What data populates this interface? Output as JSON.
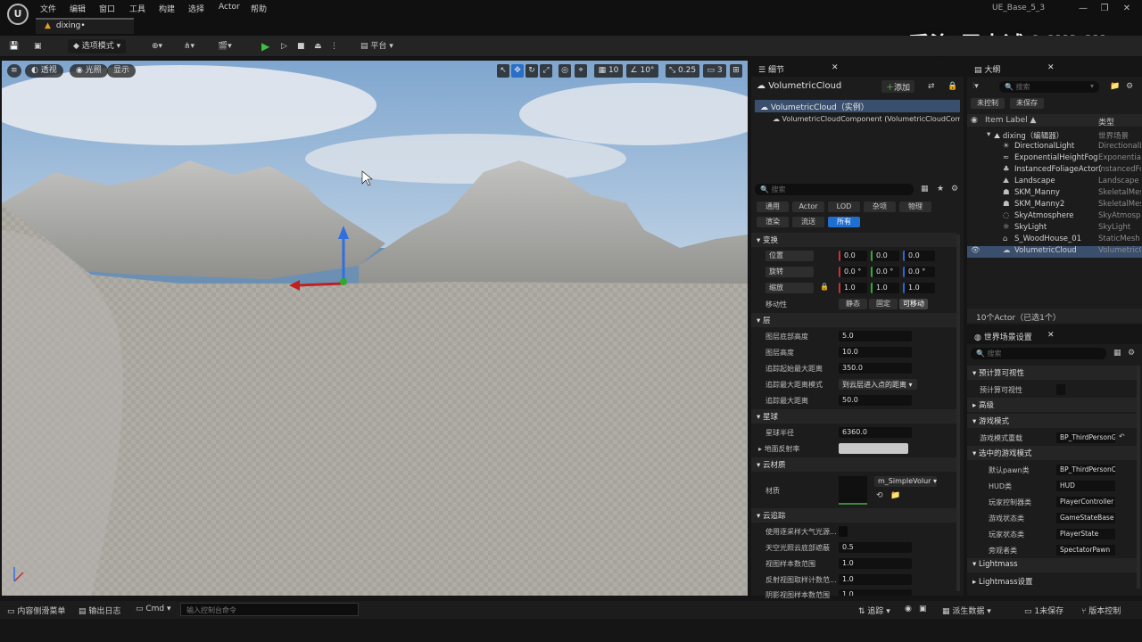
{
  "menu": [
    "文件",
    "编辑",
    "窗口",
    "工具",
    "构建",
    "选择",
    "Actor",
    "帮助"
  ],
  "map_tab": "dixing•",
  "project": "UE_Base_5_3",
  "watermark": "乔治-周士诚 bilibili",
  "toolbar": {
    "mode": "选项模式",
    "platform": "平台"
  },
  "viewport": {
    "perspective": "透视",
    "lit": "光照",
    "show": "显示",
    "grid": "10",
    "angle": "10°",
    "scale": "0.25",
    "camera": "3"
  },
  "details": {
    "tab": "细节",
    "actor": "VolumetricCloud",
    "add": "添加",
    "instance": "VolumetricCloud（实例）",
    "component": "VolumetricCloudComponent (VolumetricCloudComp",
    "search": "搜索",
    "filters": [
      "通用",
      "Actor",
      "LOD",
      "杂项",
      "物理",
      "渲染",
      "流送",
      "所有"
    ],
    "transform": {
      "section": "变换",
      "location": "位置",
      "rotation": "旋转",
      "scale": "缩放",
      "loc": [
        "0.0",
        "0.0",
        "0.0"
      ],
      "rot": [
        "0.0 °",
        "0.0 °",
        "0.0 °"
      ],
      "scl": [
        "1.0",
        "1.0",
        "1.0"
      ],
      "mobility": "移动性",
      "mob": [
        "静态",
        "固定",
        "可移动"
      ]
    },
    "layer": {
      "section": "层",
      "rows": [
        {
          "l": "图层底部高度",
          "v": "5.0"
        },
        {
          "l": "图层高度",
          "v": "10.0"
        },
        {
          "l": "追踪起始最大距离",
          "v": "350.0"
        },
        {
          "l": "追踪最大距离模式",
          "v": "到云层进入点的距离"
        },
        {
          "l": "追踪最大距离",
          "v": "50.0"
        }
      ]
    },
    "planet": {
      "section": "星球",
      "radius_l": "星球半径",
      "radius_v": "6360.0",
      "ground": "地面反射率"
    },
    "material": {
      "section": "云材质",
      "label": "材质",
      "value": "m_SimpleVolur"
    },
    "tracing": {
      "section": "云追踪",
      "rows": [
        {
          "l": "使用逐采样大气光源...",
          "v": ""
        },
        {
          "l": "天空光照云底部遮蔽",
          "v": "0.5"
        },
        {
          "l": "视图样本数范围",
          "v": "1.0"
        },
        {
          "l": "反射视图取样计数范...",
          "v": "1.0"
        },
        {
          "l": "阴影视图样本数范围",
          "v": "1.0"
        }
      ]
    }
  },
  "outliner": {
    "tab": "大纲",
    "search": "搜索",
    "unsaved_l": "未控制",
    "unsaved_r": "未保存",
    "col_label": "Item Label ▲",
    "col_type": "类型",
    "root": "dixing（编辑器）",
    "root_type": "世界场景",
    "items": [
      {
        "n": "DirectionalLight",
        "t": "DirectionalL"
      },
      {
        "n": "ExponentialHeightFog",
        "t": "ExponentialH"
      },
      {
        "n": "InstancedFoliageActor(",
        "t": "InstancedFo"
      },
      {
        "n": "Landscape",
        "t": "Landscape"
      },
      {
        "n": "SKM_Manny",
        "t": "SkeletalMes"
      },
      {
        "n": "SKM_Manny2",
        "t": "SkeletalMes"
      },
      {
        "n": "SkyAtmosphere",
        "t": "SkyAtmospl"
      },
      {
        "n": "SkyLight",
        "t": "SkyLight"
      },
      {
        "n": "S_WoodHouse_01",
        "t": "StaticMesh"
      },
      {
        "n": "VolumetricCloud",
        "t": "VolumetricC"
      }
    ],
    "footer": "10个Actor（已选1个）"
  },
  "world": {
    "tab": "世界场景设置",
    "search": "搜索",
    "s1": "预计算可视性",
    "s1r": "预计算可视性",
    "s2": "高级",
    "s3": "游戏模式",
    "gm_l": "游戏模式重载",
    "gm_v": "BP_ThirdPersonG",
    "s4": "选中的游戏模式",
    "rows": [
      {
        "l": "默认pawn类",
        "v": "BP_ThirdPersonCl"
      },
      {
        "l": "HUD类",
        "v": "HUD"
      },
      {
        "l": "玩家控制器类",
        "v": "PlayerController"
      },
      {
        "l": "游戏状态类",
        "v": "GameStateBase"
      },
      {
        "l": "玩家状态类",
        "v": "PlayerState"
      },
      {
        "l": "旁观者类",
        "v": "SpectatorPawn"
      }
    ],
    "s5": "Lightmass",
    "s6": "Lightmass设置"
  },
  "bottom": {
    "drawer": "内容侧滑菜单",
    "log": "输出日志",
    "cmd": "Cmd",
    "cmd_ph": "输入控制台命令",
    "trace": "追踪",
    "derived": "派生数据",
    "unsaved": "1未保存",
    "source": "版本控制"
  }
}
